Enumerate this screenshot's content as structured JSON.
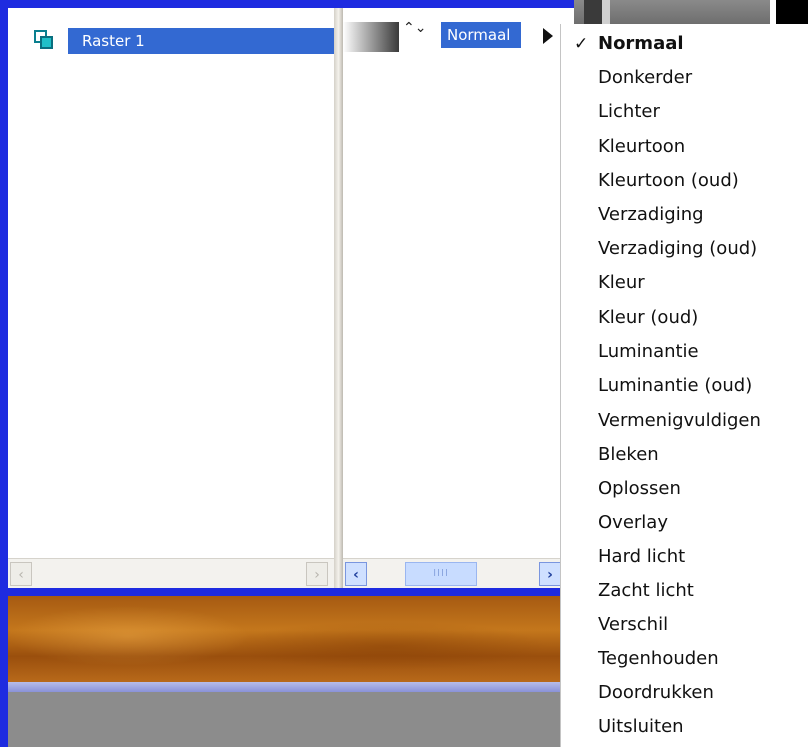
{
  "layers": {
    "items": [
      {
        "name": "Raster 1"
      }
    ]
  },
  "properties": {
    "blend_mode": "Normaal",
    "spinner_glyph": "⌃⌄"
  },
  "scrollbar": {
    "left_arrow": "‹",
    "right_arrow": "›",
    "thumb_grip": "IIII"
  },
  "blend_menu": {
    "checkmark": "✓",
    "items": [
      {
        "label": "Normaal",
        "checked": true
      },
      {
        "label": "Donkerder"
      },
      {
        "label": "Lichter"
      },
      {
        "label": "Kleurtoon"
      },
      {
        "label": "Kleurtoon (oud)"
      },
      {
        "label": "Verzadiging"
      },
      {
        "label": "Verzadiging (oud)"
      },
      {
        "label": "Kleur"
      },
      {
        "label": "Kleur (oud)"
      },
      {
        "label": "Luminantie"
      },
      {
        "label": "Luminantie (oud)"
      },
      {
        "label": "Vermenigvuldigen"
      },
      {
        "label": "Bleken"
      },
      {
        "label": "Oplossen"
      },
      {
        "label": "Overlay"
      },
      {
        "label": "Hard licht"
      },
      {
        "label": "Zacht licht"
      },
      {
        "label": "Verschil"
      },
      {
        "label": "Tegenhouden"
      },
      {
        "label": "Doordrukken"
      },
      {
        "label": "Uitsluiten"
      }
    ]
  },
  "colors": {
    "selection_blue": "#3369d2",
    "frame_blue": "#1e2be0",
    "wood_brown": "#b8691a"
  }
}
